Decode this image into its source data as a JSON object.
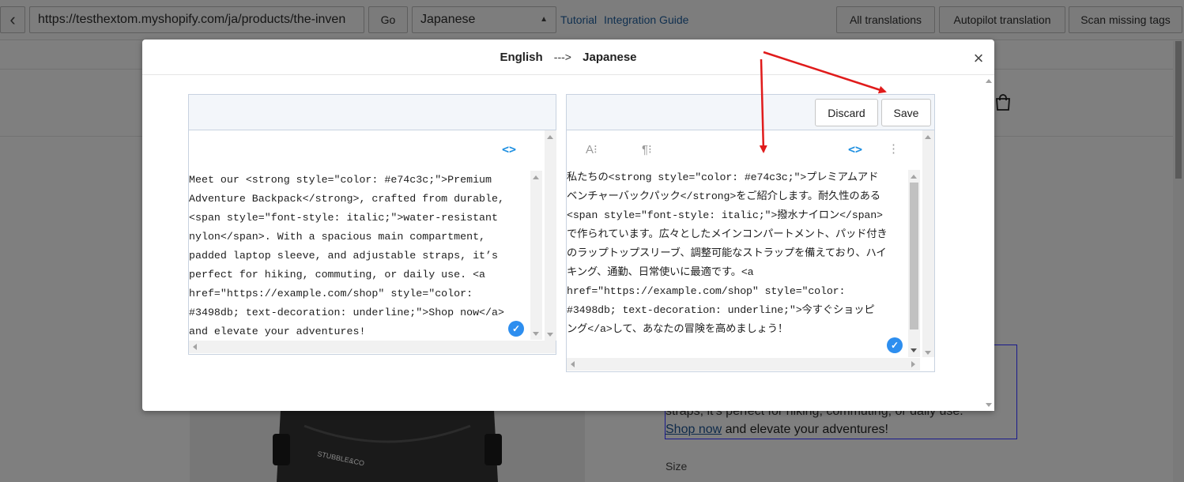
{
  "toolbar": {
    "back_glyph": "‹",
    "url": "https://testhextom.myshopify.com/ja/products/the-inven",
    "go_label": "Go",
    "language": "Japanese",
    "tutorial_label": "Tutorial",
    "guide_label": "Integration Guide",
    "all_translations_label": "All translations",
    "autopilot_label": "Autopilot translation",
    "scan_label": "Scan missing tags"
  },
  "background": {
    "desc_line1": "straps, it’s perfect for hiking, commuting, or daily use.",
    "shop_link": "Shop now",
    "desc_line2_rest": " and elevate your adventures!",
    "size_label": "Size",
    "brand_text": "STUBBLE&CO"
  },
  "modal": {
    "source_language": "English",
    "arrow": "--->",
    "target_language": "Japanese",
    "close_glyph": "×",
    "source_text": "Meet our <strong style=\"color: #e74c3c;\">Premium\nAdventure Backpack</strong>, crafted from durable,\n<span style=\"font-style: italic;\">water-resistant\nnylon</span>. With a spacious main compartment,\npadded laptop sleeve, and adjustable straps, it’s\nperfect for hiking, commuting, or daily use. <a\nhref=\"https://example.com/shop\" style=\"color:\n#3498db; text-decoration: underline;\">Shop now</a>\nand elevate your adventures!",
    "target_text": "私たちの<strong style=\"color: #e74c3c;\">プレミアムアド\nベンチャーバックパック</strong>をご紹介します。耐久性のある\n<span style=\"font-style: italic;\">撥水ナイロン</span>\nで作られています。広々としたメインコンパートメント、パッド付き\nのラップトップスリーブ、調整可能なストラップを備えており、ハイ\nキング、通勤、日常使いに最適です。<a\nhref=\"https://example.com/shop\" style=\"color:\n#3498db; text-decoration: underline;\">今すぐショッピ\nング</a>して、あなたの冒険を高めましょう！",
    "discard_label": "Discard",
    "save_label": "Save",
    "code_icon_glyph": "<>",
    "font_tool_glyph": "A⁝",
    "para_tool_glyph": "¶⁝",
    "more_glyph": "⋮",
    "check_glyph": "✓"
  },
  "colors": {
    "accent": "#1d8fe1",
    "annotation_arrow": "#e01b1b"
  }
}
